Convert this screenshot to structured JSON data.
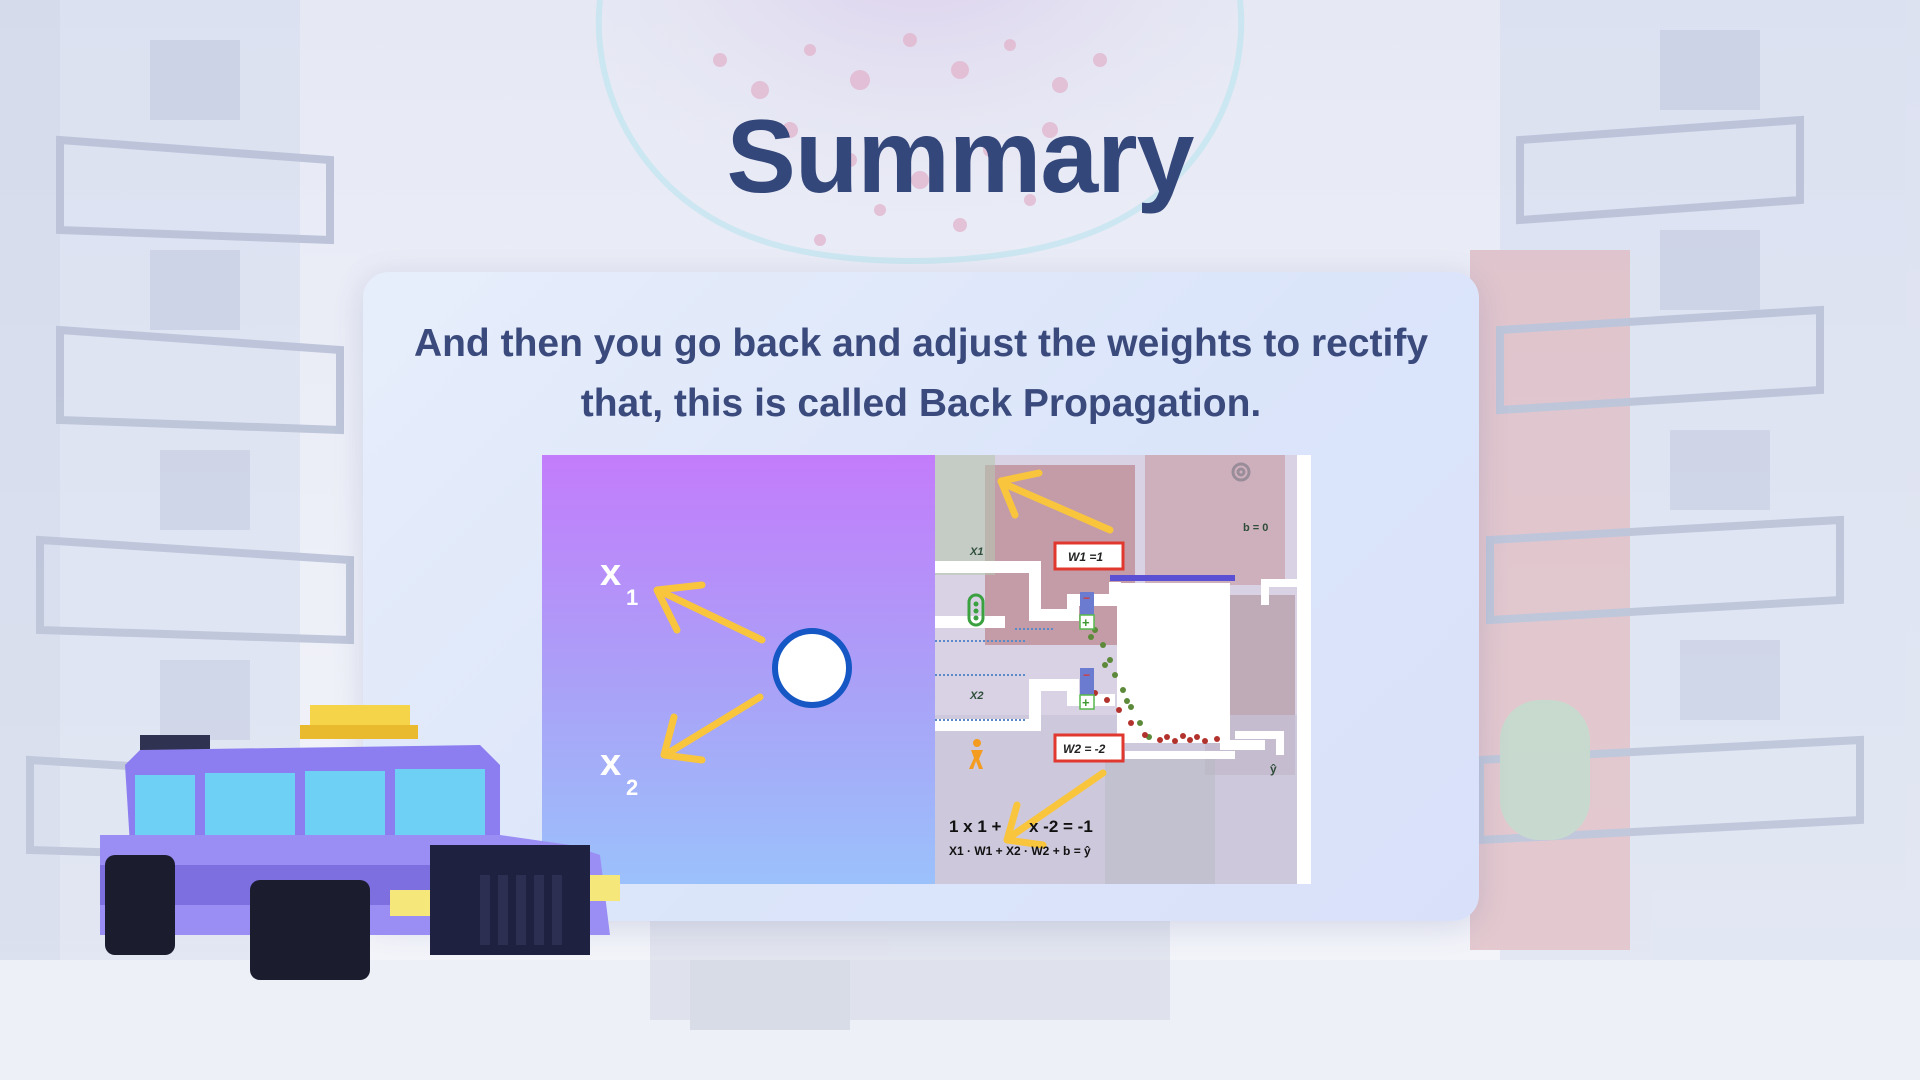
{
  "slide": {
    "title": "Summary",
    "body": "And then you go back and adjust the weights to rectify that, this is called Back Propagation."
  },
  "diagram_left": {
    "input_1": "x",
    "input_1_sub": "1",
    "input_2": "x",
    "input_2_sub": "2"
  },
  "diagram_right": {
    "x1_label": "X1",
    "x2_label": "X2",
    "b_label": "b = 0",
    "w1_box": "W1 =1",
    "w2_box": "W2 = -2",
    "yhat_label": "ŷ",
    "equation_partial": "1 x 1 +",
    "equation_rest": "x -2 = -1",
    "formula": "X1 · W1 + X2 · W2 + b = ŷ",
    "minus_sign": "−",
    "plus_sign": "+"
  },
  "colors": {
    "title": "#34477a",
    "body_text": "#3b4a7c",
    "arrow": "#f9c53d",
    "weight_box": "#e0382e",
    "neuron_border": "#1557c4",
    "taxi_body": "#8c7ef0",
    "taxi_glass": "#6fd0f5",
    "taxi_sign": "#f6d44a"
  },
  "icons": {
    "settings": "gear-icon",
    "traffic_light": "traffic-light-icon",
    "pedestrian": "pedestrian-icon"
  }
}
